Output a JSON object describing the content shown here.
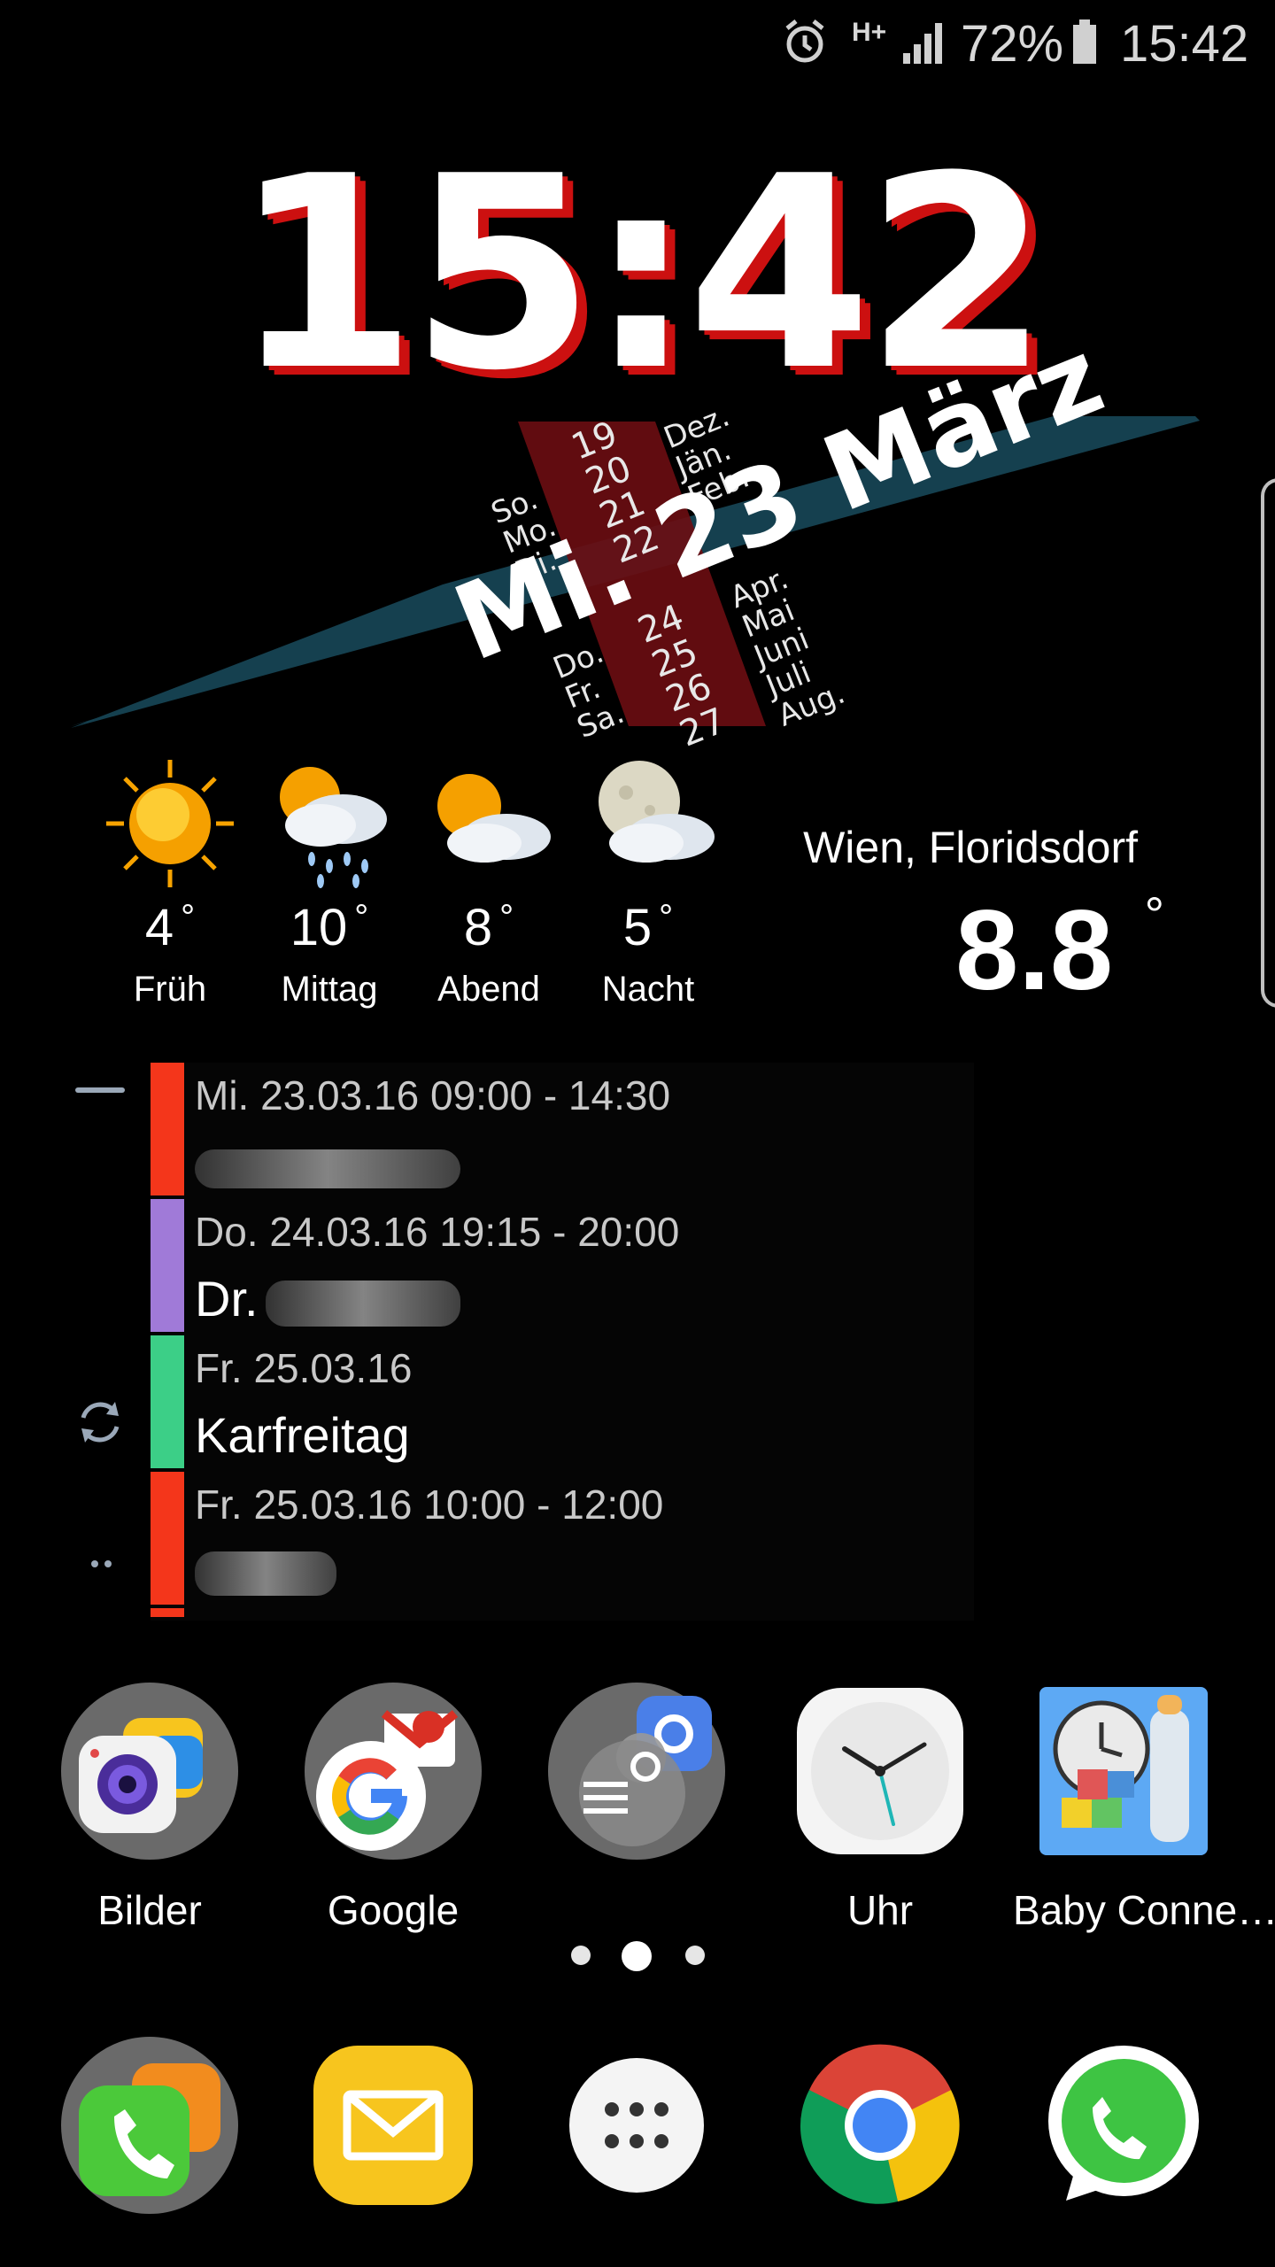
{
  "status_bar": {
    "network": "H+",
    "battery": "72%",
    "time": "15:42",
    "icons": [
      "alarm-icon",
      "hplus-icon",
      "signal-icon",
      "battery-icon"
    ]
  },
  "clock_widget": {
    "time": "15:42"
  },
  "date_widget": {
    "weekday": "Mi.",
    "day": "23",
    "month": "März",
    "weekdays_before": [
      "So.",
      "Mo.",
      "Di."
    ],
    "weekdays_after": [
      "Do.",
      "Fr.",
      "Sa."
    ],
    "days_before": [
      "19",
      "20",
      "21",
      "22"
    ],
    "days_after": [
      "24",
      "25",
      "26",
      "27"
    ],
    "months_before": [
      "Dez.",
      "Jän.",
      "Feb."
    ],
    "months_after": [
      "Apr.",
      "Mai",
      "Juni",
      "Juli",
      "Aug."
    ],
    "colors": {
      "banner": "#15404f",
      "day_band": "#6b0d12"
    }
  },
  "weather": {
    "location": "Wien, Floridsdorf",
    "current_temp": "8.8",
    "degree": "°",
    "forecast": [
      {
        "temp": "4",
        "label": "Früh",
        "icon": "sun-icon"
      },
      {
        "temp": "10",
        "label": "Mittag",
        "icon": "sun-rain-cloud-icon"
      },
      {
        "temp": "8",
        "label": "Abend",
        "icon": "sun-cloud-icon"
      },
      {
        "temp": "5",
        "label": "Nacht",
        "icon": "moon-cloud-icon"
      }
    ]
  },
  "agenda": {
    "events": [
      {
        "time": "Mi. 23.03.16 09:00 - 14:30",
        "title": "",
        "color": "#f4361b"
      },
      {
        "time": "Do. 24.03.16 19:15 - 20:00",
        "title": "Dr.",
        "color": "#a07ad8"
      },
      {
        "time": "Fr. 25.03.16",
        "title": "Karfreitag",
        "color": "#3ccf87"
      },
      {
        "time": "Fr. 25.03.16 10:00 - 12:00",
        "title": "",
        "color": "#f4361b"
      }
    ]
  },
  "home_apps": [
    {
      "label": "Bilder",
      "icon": "gallery-folder-icon"
    },
    {
      "label": "Google",
      "icon": "google-folder-icon"
    },
    {
      "label": "",
      "icon": "settings-folder-icon"
    },
    {
      "label": "Uhr",
      "icon": "clock-icon"
    },
    {
      "label": "Baby Conne…",
      "icon": "baby-connect-icon"
    }
  ],
  "dock_apps": [
    {
      "icon": "phone-icon"
    },
    {
      "icon": "email-icon"
    },
    {
      "icon": "apps-drawer-icon"
    },
    {
      "icon": "chrome-icon"
    },
    {
      "icon": "whatsapp-icon"
    }
  ],
  "page_indicator": {
    "count": 3,
    "active": 2
  }
}
